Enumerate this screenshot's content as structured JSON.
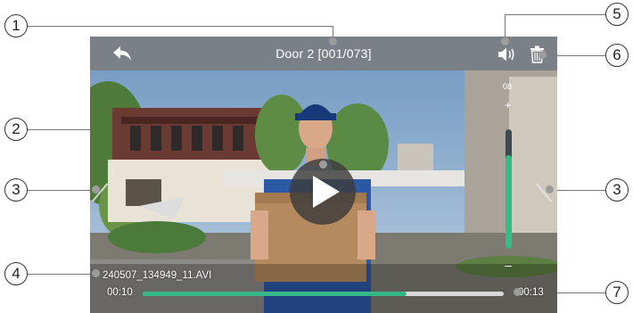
{
  "header": {
    "title": "Door 2 [001/073]"
  },
  "player": {
    "filename": "240507_134949_11.AVI",
    "time_current": "00:10",
    "time_total": "00:13",
    "progress": 0.73
  },
  "volume": {
    "level_label": "08",
    "plus": "+",
    "minus": "–",
    "level": 0.78
  },
  "callouts": [
    "1",
    "2",
    "3",
    "3",
    "4",
    "5",
    "6",
    "7"
  ],
  "colors": {
    "accent": "#35b787",
    "topbar": "#7b7f86"
  },
  "icons": [
    "back-arrow-icon",
    "speaker-icon",
    "trash-icon",
    "play-icon"
  ]
}
